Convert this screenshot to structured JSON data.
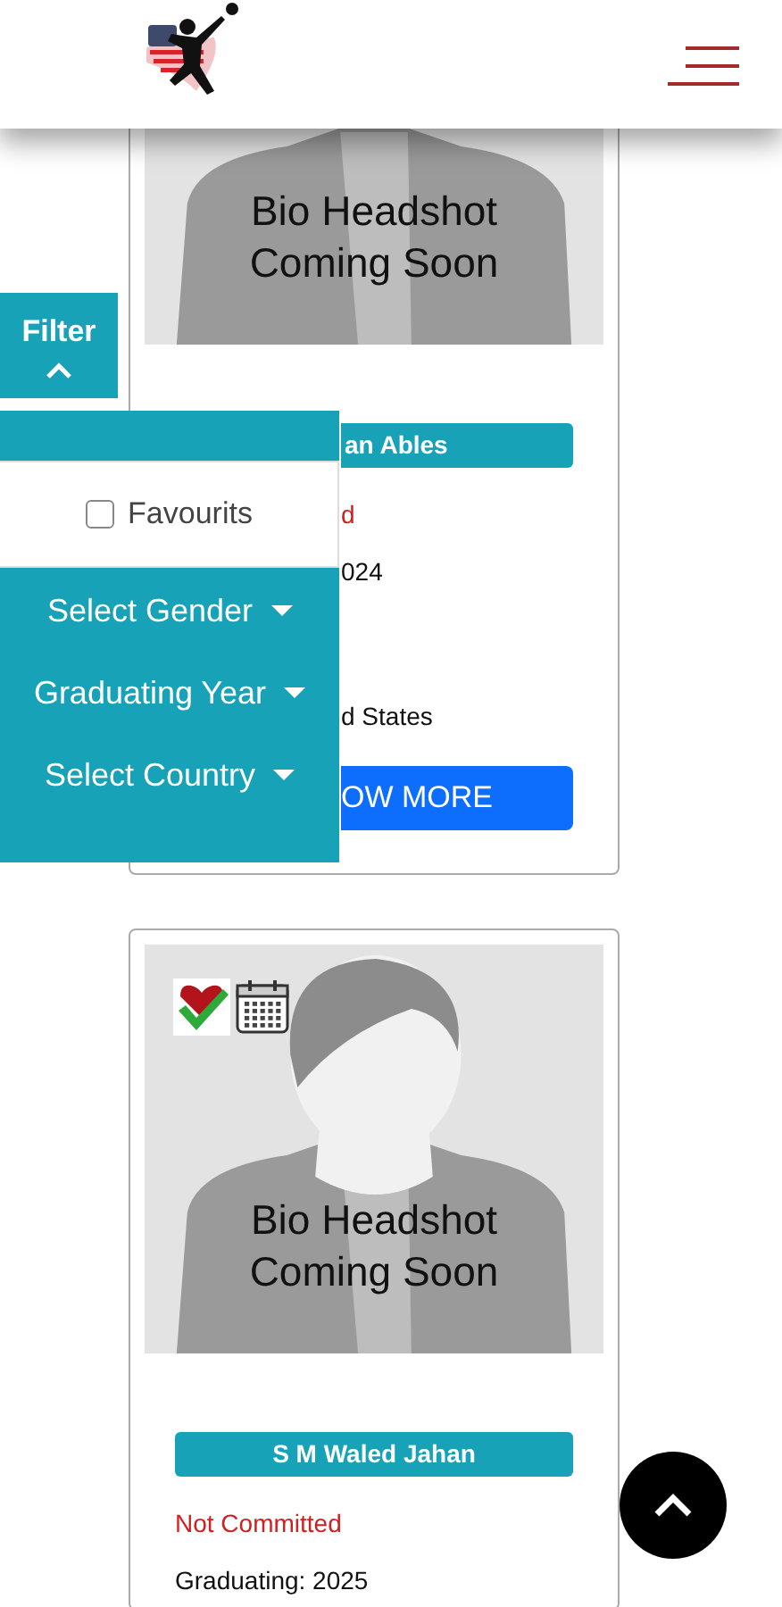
{
  "filter": {
    "label": "Filter",
    "expanded": true,
    "favourites": {
      "label": "Favourits",
      "checked": false
    },
    "dropdowns": [
      "Select Gender",
      "Graduating Year",
      "Select Country"
    ]
  },
  "cards": [
    {
      "headshot_caption": [
        "Bio Headshot",
        "Coming Soon"
      ],
      "name": "an Ables",
      "status": "d",
      "graduating": "024",
      "country": "d States",
      "button": "OW MORE"
    },
    {
      "headshot_caption": [
        "Bio Headshot",
        "Coming Soon"
      ],
      "badges": [
        {
          "kind": "favourite"
        },
        {
          "kind": "calendar"
        }
      ],
      "name": "S M Waled Jahan",
      "status": "Not Committed",
      "graduating": "Graduating: 2025"
    }
  ]
}
